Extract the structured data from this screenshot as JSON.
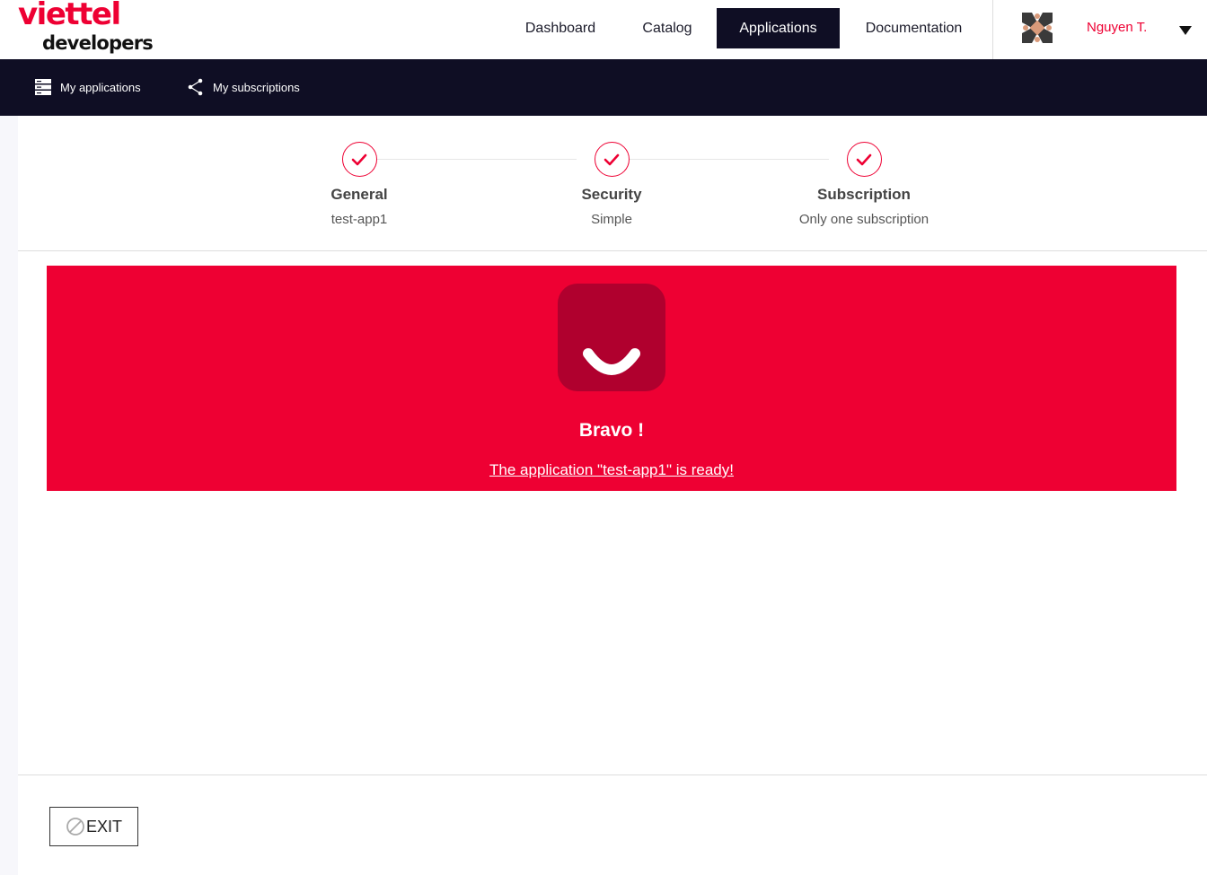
{
  "brand": {
    "name": "viettel",
    "tagline": "developers"
  },
  "nav": {
    "items": [
      {
        "label": "Dashboard",
        "active": false
      },
      {
        "label": "Catalog",
        "active": false
      },
      {
        "label": "Applications",
        "active": true
      },
      {
        "label": "Documentation",
        "active": false
      }
    ]
  },
  "user": {
    "name": "Nguyen T.",
    "avatar_icon": "geometric-avatar",
    "menu_icon": "caret-down-icon"
  },
  "subnav": {
    "items": [
      {
        "label": "My applications",
        "icon": "server-icon"
      },
      {
        "label": "My subscriptions",
        "icon": "share-icon"
      }
    ]
  },
  "stepper": {
    "steps": [
      {
        "title": "General",
        "value": "test-app1",
        "status": "complete"
      },
      {
        "title": "Security",
        "value": "Simple",
        "status": "complete"
      },
      {
        "title": "Subscription",
        "value": "Only one subscription",
        "status": "complete"
      }
    ]
  },
  "result": {
    "icon": "smile-icon",
    "title": "Bravo !",
    "message": "The application \"test-app1\" is ready!"
  },
  "footer": {
    "exit_label": "EXIT",
    "exit_icon": "cancel-icon"
  },
  "colors": {
    "accent": "#ee0033",
    "navy": "#0f0e24",
    "smile_bg": "#b0002e"
  }
}
